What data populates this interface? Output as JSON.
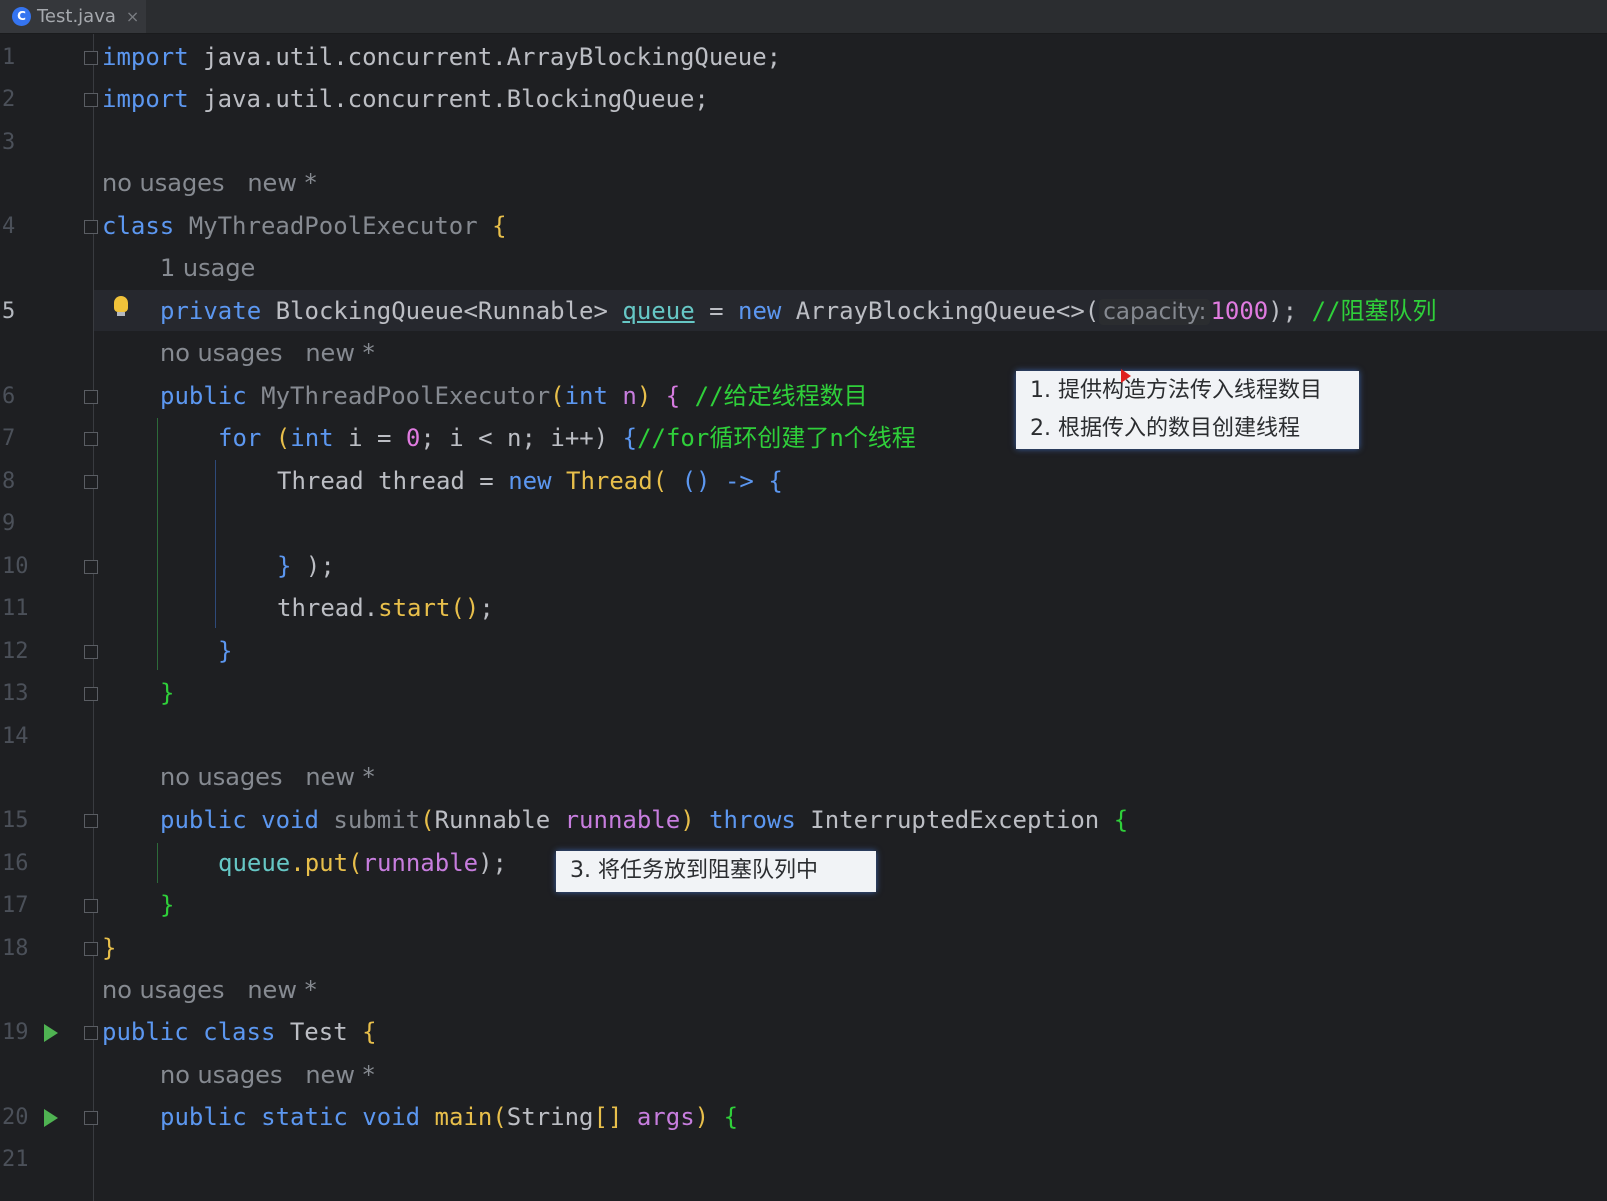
{
  "tab": {
    "file_icon": "C",
    "filename": "Test.java",
    "close": "×"
  },
  "line_numbers": [
    "1",
    "2",
    "3",
    "4",
    "5",
    "6",
    "7",
    "8",
    "9",
    "10",
    "11",
    "12",
    "13",
    "14",
    "15",
    "16",
    "17",
    "18",
    "19",
    "20",
    "21"
  ],
  "hints": {
    "class_executor": {
      "usages": "no usages",
      "new": "new *"
    },
    "queue_field": {
      "usages": "1 usage"
    },
    "constructor": {
      "usages": "no usages",
      "new": "new *"
    },
    "submit": {
      "usages": "no usages",
      "new": "new *"
    },
    "class_test": {
      "usages": "no usages",
      "new": "new *"
    },
    "main": {
      "usages": "no usages",
      "new": "new *"
    }
  },
  "code": {
    "l1": {
      "kw": "import",
      "rest": " java.util.concurrent.ArrayBlockingQueue;"
    },
    "l2": {
      "kw": "import",
      "rest": " java.util.concurrent.BlockingQueue;"
    },
    "l4": {
      "kw": "class",
      "name": " MyThreadPoolExecutor ",
      "brace": "{"
    },
    "l5": {
      "kw": "private",
      "type": " BlockingQueue<Runnable> ",
      "field": "queue",
      "eq": " = ",
      "new": "new",
      "ctor": " ArrayBlockingQueue<>(",
      "hint": "capacity:",
      "num": "1000",
      "end": "); ",
      "comment": "//阻塞队列"
    },
    "l6": {
      "kw": "public",
      "name": " MyThreadPoolExecutor",
      "open": "(",
      "int": "int",
      "param": " n",
      "close": ") ",
      "brace": "{ ",
      "comment": "//给定线程数目"
    },
    "l7": {
      "kw": "for",
      "open": " (",
      "int": "int",
      "a": " i = ",
      "zero": "0",
      "b": "; i < n; i++) ",
      "brace": "{",
      "comment": "//for循环创建了n个线程"
    },
    "l8": {
      "a": "Thread thread = ",
      "new": "new",
      "b": " Thread",
      "open": "( ",
      "lam": "() -> ",
      "brace": "{"
    },
    "l10": {
      "brace": "} ",
      "end": ");"
    },
    "l11": {
      "a": "thread.",
      "fn": "start",
      "open": "()",
      "end": ";"
    },
    "l12": {
      "brace": "}"
    },
    "l13": {
      "brace": "}"
    },
    "l15": {
      "kw": "public",
      "void": " void",
      "name": " submit",
      "open": "(",
      "type": "Runnable ",
      "param": "runnable",
      "close": ") ",
      "throws": "throws",
      "exc": " InterruptedException ",
      "brace": "{"
    },
    "l16": {
      "field": "queue",
      "a": ".put",
      "open": "(",
      "param": "runnable",
      "end": ");"
    },
    "l17": {
      "brace": "}"
    },
    "l18": {
      "brace": "}"
    },
    "l19": {
      "kw": "public class",
      "name": " Test ",
      "brace": "{"
    },
    "l20": {
      "kw": "public static void",
      "name": " main",
      "open": "(",
      "type": "String",
      "arr": "[]",
      "param": " args",
      "close": ") ",
      "brace": "{"
    }
  },
  "notes": {
    "constructor": [
      "1. 提供构造方法传入线程数目",
      "2. 根据传入的数目创建线程"
    ],
    "submit": [
      "3. 将任务放到阻塞队列中"
    ]
  }
}
